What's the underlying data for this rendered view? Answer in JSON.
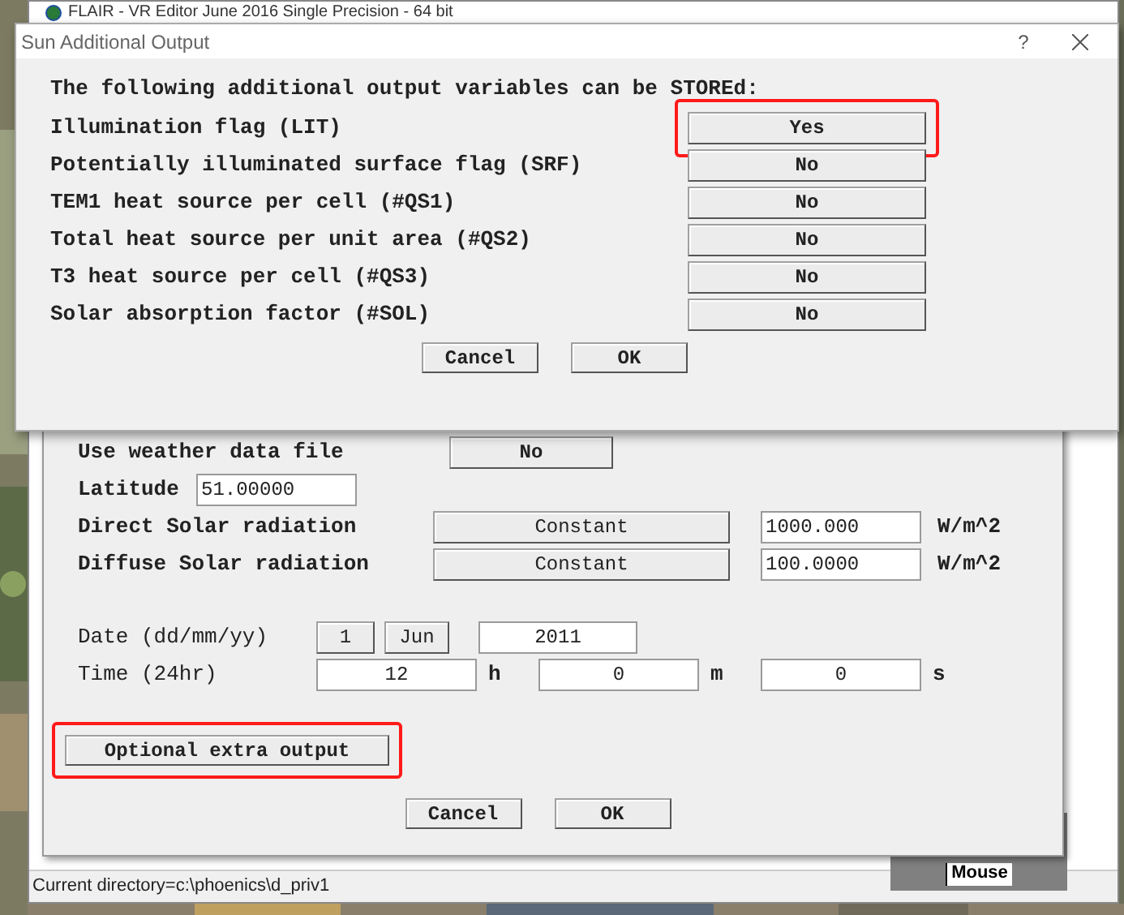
{
  "app_window": {
    "title": "FLAIR - VR Editor June 2016 Single Precision - 64 bit",
    "status_bar": "Current directory=c:\\phoenics\\d_priv1",
    "side_button": "Mouse"
  },
  "sun_panel": {
    "weather": {
      "label": "Use weather data file",
      "value": "No"
    },
    "latitude": {
      "label": "Latitude",
      "value": "51.00000"
    },
    "radiation": [
      {
        "label": "Direct Solar radiation",
        "mode": "Constant",
        "value": "1000.000",
        "unit": "W/m^2"
      },
      {
        "label": "Diffuse Solar radiation",
        "mode": "Constant",
        "value": "100.0000",
        "unit": "W/m^2"
      }
    ],
    "date": {
      "label": "Date (dd/mm/yy)",
      "day": "1",
      "month": "Jun",
      "year": "2011"
    },
    "time": {
      "label": "Time (24hr)",
      "fields": [
        {
          "value": "12",
          "unit": "h"
        },
        {
          "value": "0",
          "unit": "m"
        },
        {
          "value": "0",
          "unit": "s"
        }
      ]
    },
    "extra_output": {
      "label": "Optional extra output",
      "highlighted": true
    },
    "buttons": [
      "Cancel",
      "OK"
    ]
  },
  "dialog": {
    "title": "Sun Additional Output",
    "help": "?",
    "intro": "The following additional output variables can be STOREd:",
    "outputs": [
      {
        "label": "Illumination flag (LIT)",
        "value": "Yes",
        "highlighted": true
      },
      {
        "label": "Potentially illuminated surface flag (SRF)",
        "value": "No",
        "highlighted": false
      },
      {
        "label": "TEM1 heat source per cell (#QS1)",
        "value": "No",
        "highlighted": false
      },
      {
        "label": "Total heat source per unit area (#QS2)",
        "value": "No",
        "highlighted": false
      },
      {
        "label": "T3 heat source per cell (#QS3)",
        "value": "No",
        "highlighted": false
      },
      {
        "label": "Solar absorption factor (#SOL)",
        "value": "No",
        "highlighted": false
      }
    ],
    "buttons": [
      "Cancel",
      "OK"
    ]
  }
}
